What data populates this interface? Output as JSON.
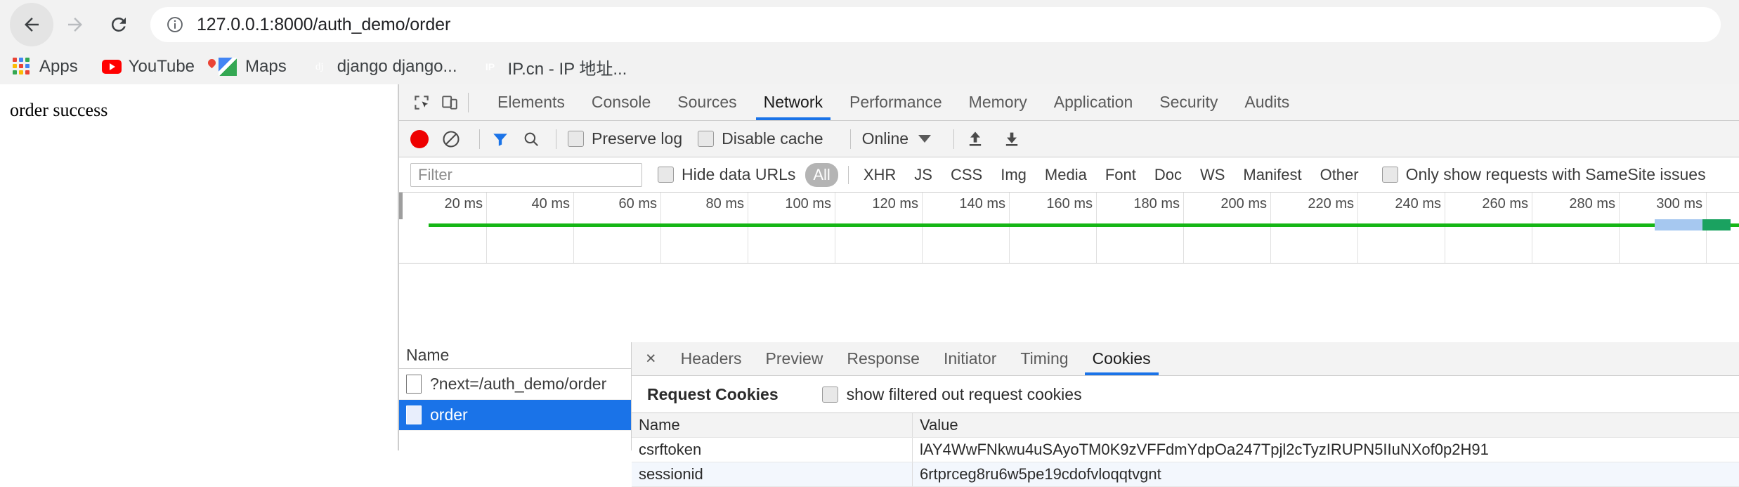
{
  "browser": {
    "back_icon": "back-arrow-icon",
    "forward_icon": "forward-arrow-icon",
    "reload_icon": "reload-icon",
    "info_icon": "page-info-icon",
    "url_host": "127.0.0.1:8000",
    "url_path": "/auth_demo/order",
    "url_full": "127.0.0.1:8000/auth_demo/order"
  },
  "bookmarks": [
    {
      "label": "Apps",
      "icon": "apps-grid-icon"
    },
    {
      "label": "YouTube",
      "icon": "youtube-icon"
    },
    {
      "label": "Maps",
      "icon": "google-maps-icon"
    },
    {
      "label": "django django...",
      "icon": "django-favicon-icon"
    },
    {
      "label": "IP.cn - IP 地址...",
      "icon": "ipcn-favicon-icon"
    }
  ],
  "page": {
    "body_text": "order success"
  },
  "devtools": {
    "inspect_icon": "inspect-element-icon",
    "device_icon": "device-toolbar-icon",
    "tabs": [
      {
        "label": "Elements",
        "selected": false
      },
      {
        "label": "Console",
        "selected": false
      },
      {
        "label": "Sources",
        "selected": false
      },
      {
        "label": "Network",
        "selected": true
      },
      {
        "label": "Performance",
        "selected": false
      },
      {
        "label": "Memory",
        "selected": false
      },
      {
        "label": "Application",
        "selected": false
      },
      {
        "label": "Security",
        "selected": false
      },
      {
        "label": "Audits",
        "selected": false
      }
    ],
    "toolbar": {
      "record_icon": "record-stop-icon",
      "clear_icon": "clear-icon",
      "filter_icon": "filter-funnel-icon",
      "search_icon": "search-icon",
      "preserve_log_label": "Preserve log",
      "preserve_log_checked": false,
      "disable_cache_label": "Disable cache",
      "disable_cache_checked": false,
      "throttling_value": "Online",
      "import_icon": "import-har-icon",
      "export_icon": "export-har-icon"
    },
    "filterbar": {
      "filter_placeholder": "Filter",
      "filter_value": "",
      "hide_data_urls_label": "Hide data URLs",
      "hide_data_urls_checked": false,
      "types": [
        {
          "label": "All",
          "active": true
        },
        {
          "label": "XHR",
          "active": false
        },
        {
          "label": "JS",
          "active": false
        },
        {
          "label": "CSS",
          "active": false
        },
        {
          "label": "Img",
          "active": false
        },
        {
          "label": "Media",
          "active": false
        },
        {
          "label": "Font",
          "active": false
        },
        {
          "label": "Doc",
          "active": false
        },
        {
          "label": "WS",
          "active": false
        },
        {
          "label": "Manifest",
          "active": false
        },
        {
          "label": "Other",
          "active": false
        }
      ],
      "samesite_label": "Only show requests with SameSite issues",
      "samesite_checked": false
    },
    "timeline": {
      "ticks": [
        "20 ms",
        "40 ms",
        "60 ms",
        "80 ms",
        "100 ms",
        "120 ms",
        "140 ms",
        "160 ms",
        "180 ms",
        "200 ms",
        "220 ms",
        "240 ms",
        "260 ms",
        "280 ms",
        "300 ms"
      ],
      "overview_bar_color": "#16b616",
      "request_bar_blue": "#a6c8f0",
      "request_bar_green": "#1aa260"
    },
    "requests": {
      "column_header": "Name",
      "rows": [
        {
          "name": "?next=/auth_demo/order",
          "selected": false,
          "icon": "document-icon"
        },
        {
          "name": "order",
          "selected": true,
          "icon": "document-icon"
        }
      ]
    },
    "detail": {
      "close_label": "×",
      "tabs": [
        {
          "label": "Headers",
          "selected": false
        },
        {
          "label": "Preview",
          "selected": false
        },
        {
          "label": "Response",
          "selected": false
        },
        {
          "label": "Initiator",
          "selected": false
        },
        {
          "label": "Timing",
          "selected": false
        },
        {
          "label": "Cookies",
          "selected": true
        }
      ],
      "cookies": {
        "section_title": "Request Cookies",
        "show_filtered_label": "show filtered out request cookies",
        "show_filtered_checked": false,
        "columns": [
          "Name",
          "Value"
        ],
        "rows": [
          {
            "name": "csrftoken",
            "value": "lAY4WwFNkwu4uSAyoTM0K9zVFFdmYdpOa247Tpjl2cTyzIRUPN5IIuNXof0p2H91"
          },
          {
            "name": "sessionid",
            "value": "6rtprceg8ru6w5pe19cdofvloqqtvgnt"
          }
        ]
      }
    }
  },
  "colors": {
    "accent": "#1a73e8",
    "chrome_bg": "#f2f2f2",
    "devtools_bg": "#f3f3f3",
    "record_red": "#ee0000"
  }
}
